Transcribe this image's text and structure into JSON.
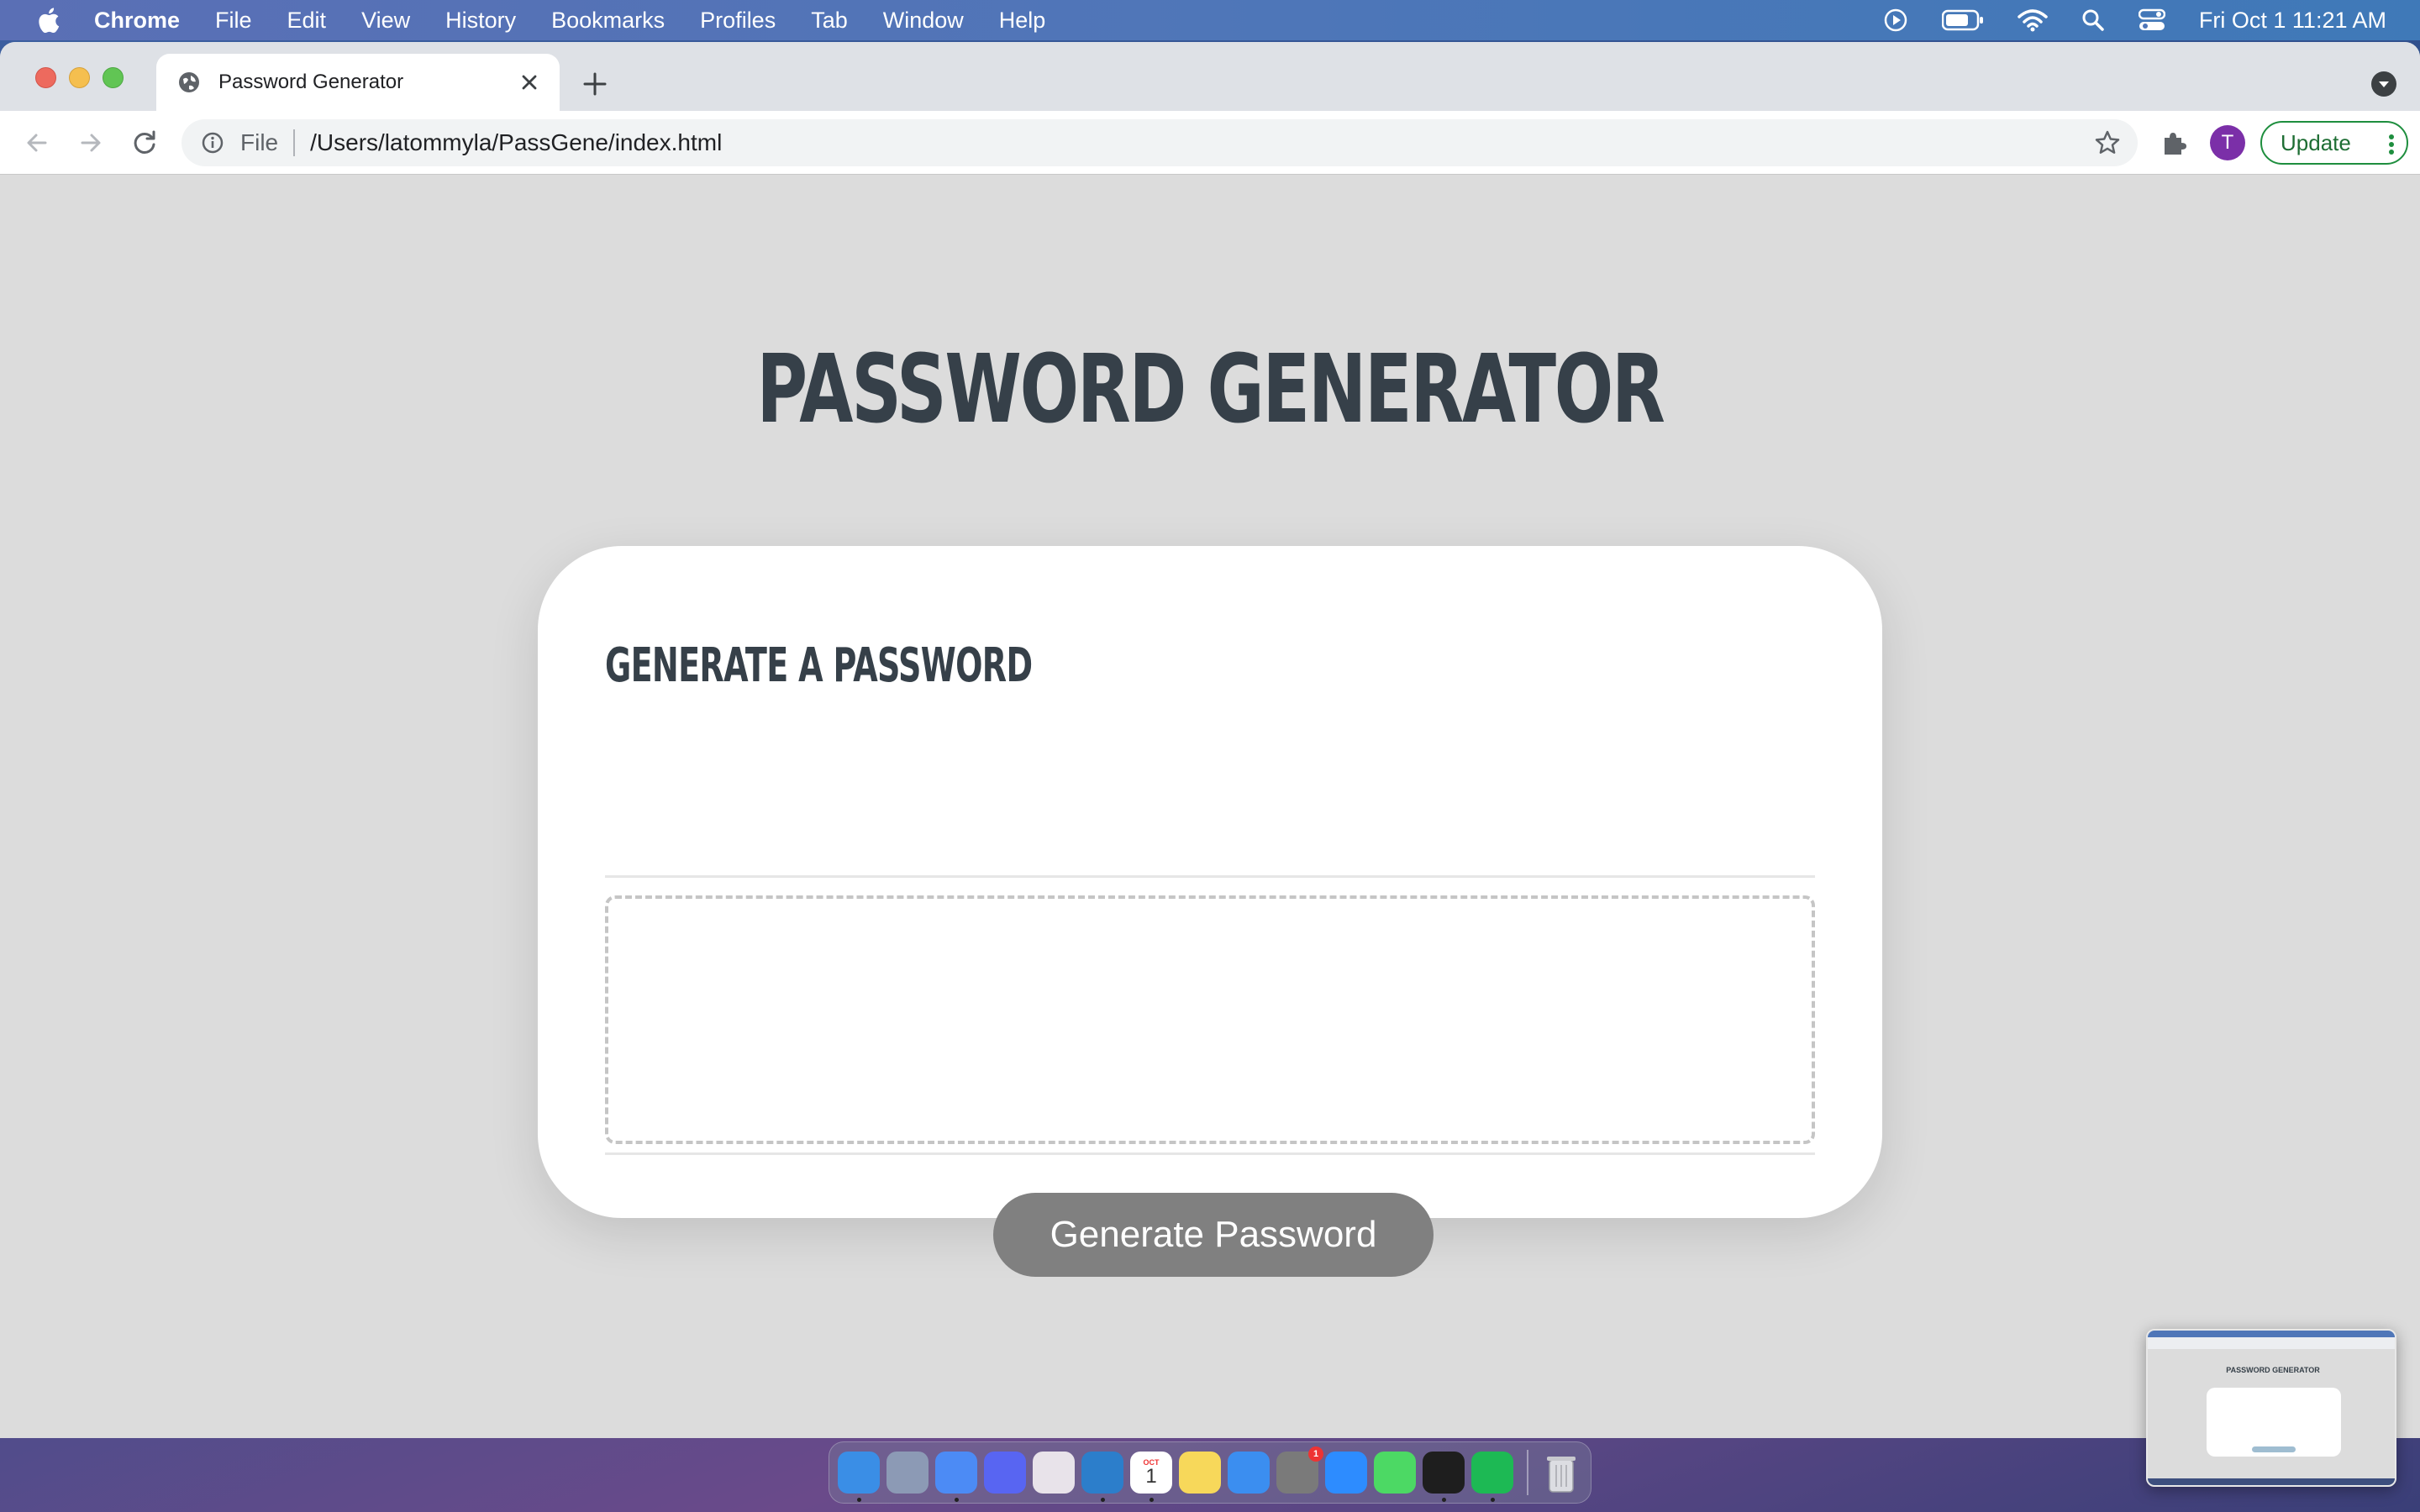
{
  "menubar": {
    "app_name": "Chrome",
    "menus": [
      "File",
      "Edit",
      "View",
      "History",
      "Bookmarks",
      "Profiles",
      "Tab",
      "Window",
      "Help"
    ],
    "clock": "Fri Oct 1  11:21 AM",
    "status_icons": [
      "play-icon",
      "battery-icon",
      "wifi-icon",
      "spotlight-icon",
      "control-center-icon"
    ]
  },
  "browser": {
    "tab_title": "Password Generator",
    "address_scheme": "File",
    "address_url": "/Users/latommyla/PassGene/index.html",
    "avatar_initial": "T",
    "update_label": "Update"
  },
  "page": {
    "title": "PASSWORD GENERATOR",
    "card_header": "GENERATE A PASSWORD",
    "password_value": "",
    "generate_button": "Generate Password"
  },
  "dock": {
    "apps": [
      {
        "name": "finder",
        "color": "#3a8ee6",
        "running": true
      },
      {
        "name": "launchpad",
        "color": "#8c9ab5",
        "running": false
      },
      {
        "name": "chrome",
        "color": "#4c8bf5",
        "running": true
      },
      {
        "name": "discord",
        "color": "#5865f2",
        "running": false
      },
      {
        "name": "slack",
        "color": "#e8e3ea",
        "running": false
      },
      {
        "name": "vscode",
        "color": "#2c7ecb",
        "running": true
      },
      {
        "name": "calendar",
        "color": "#ffffff",
        "running": true
      },
      {
        "name": "notes",
        "color": "#f7d85a",
        "running": false
      },
      {
        "name": "safari",
        "color": "#3b8ef0",
        "running": false
      },
      {
        "name": "system-preferences",
        "color": "#7a7a7a",
        "running": false
      },
      {
        "name": "zoom",
        "color": "#2d8cff",
        "running": false
      },
      {
        "name": "messages",
        "color": "#4cd964",
        "running": false
      },
      {
        "name": "terminal",
        "color": "#1e1e1e",
        "running": true
      },
      {
        "name": "spotify",
        "color": "#1db954",
        "running": true
      }
    ],
    "calendar_month": "OCT",
    "calendar_day": "1",
    "badge_count": "1"
  },
  "thumbnail": {
    "title": "PASSWORD GENERATOR"
  },
  "colors": {
    "title_text": "#364049",
    "button_bg": "#808080",
    "page_bg": "#dcdcdc"
  }
}
